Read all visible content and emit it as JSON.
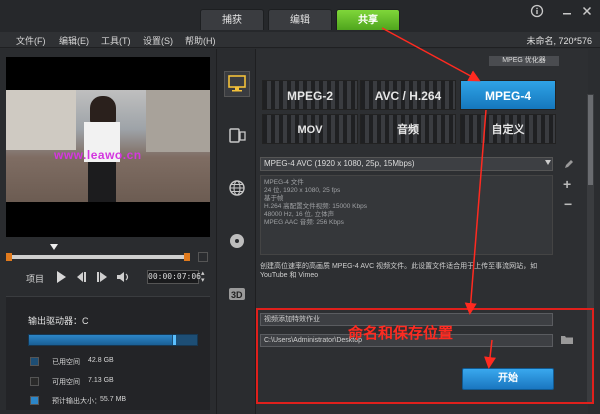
{
  "tabs": [
    {
      "label": "捕获",
      "active": false
    },
    {
      "label": "编辑",
      "active": false
    },
    {
      "label": "共享",
      "active": true
    }
  ],
  "window_buttons": [
    "info-icon",
    "minimize-icon",
    "close-icon"
  ],
  "menu": [
    "文件(F)",
    "编辑(E)",
    "工具(T)",
    "设置(S)",
    "帮助(H)"
  ],
  "project_info": "未命名, 720*576",
  "preview": {
    "watermark": "www.leawo.cn",
    "project_label": "项目",
    "timecode": "00:00:07:06"
  },
  "drive": {
    "label": "输出驱动器：C",
    "used_fraction": 0.85,
    "legend": [
      {
        "label": "已用空间",
        "value": "42.8 GB",
        "color": "#1d4e75"
      },
      {
        "label": "可用空间",
        "value": "7.13 GB",
        "color": "#2a2a2a"
      },
      {
        "label": "预计输出大小：",
        "value": "55.7 MB",
        "color": "#2c86c8"
      }
    ]
  },
  "sidebar_icons": [
    "computer-icon",
    "device-icon",
    "web-icon",
    "disc-icon",
    "3d-icon"
  ],
  "formats": {
    "optimizer_label": "MPEG 优化器",
    "items": [
      "MPEG-2",
      "AVC / H.264",
      "MPEG-4",
      "MOV",
      "音频",
      "自定义"
    ],
    "selected": "MPEG-4"
  },
  "profile": {
    "selected": "MPEG-4 AVC (1920 x 1080, 25p, 15Mbps)",
    "details": [
      "MPEG-4 文件",
      "24 位, 1920 x 1080, 25 fps",
      "基于帧",
      "H.264 高配置文件视频: 15000 Kbps",
      "48000 Hz, 16 位, 立体声",
      "MPEG AAC 音频: 256 Kbps"
    ]
  },
  "description": "创建高位速率的高画质 MPEG-4 AVC 视频文件。此设置文件适合用于上传至事流网站，如 YouTube 和 Vimeo",
  "output": {
    "name_placeholder": "视频添加特效作业",
    "path": "C:\\Users\\Administrator\\Desktop",
    "annotation": "命名和保存位置",
    "start_label": "开始"
  }
}
